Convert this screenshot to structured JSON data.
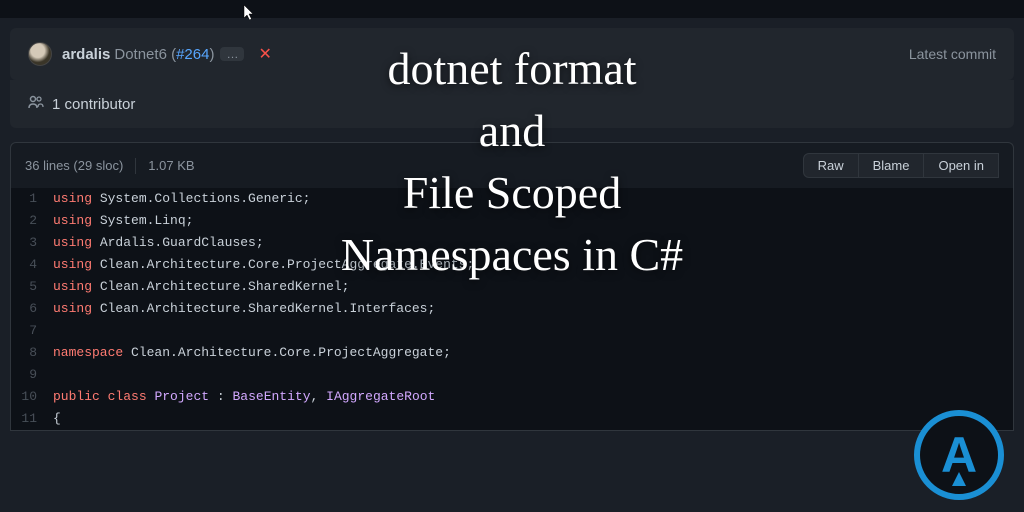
{
  "overlay": {
    "line1": "dotnet format",
    "line2": "and",
    "line3": "File Scoped",
    "line4": "Namespaces in C#"
  },
  "commit": {
    "author": "ardalis",
    "message_prefix": "Dotnet6 (",
    "pr_link": "#264",
    "message_suffix": ")",
    "latest_commit_label": "Latest commit"
  },
  "contributors": {
    "count_label": "1 contributor"
  },
  "file_header": {
    "lines": "36 lines (29 sloc)",
    "size": "1.07 KB",
    "actions": {
      "raw": "Raw",
      "blame": "Blame",
      "open": "Open in"
    }
  },
  "code_lines": [
    {
      "n": "1",
      "using": "using",
      "ns": "System.Collections.Generic"
    },
    {
      "n": "2",
      "using": "using",
      "ns": "System.Linq"
    },
    {
      "n": "3",
      "using": "using",
      "ns": "Ardalis.GuardClauses"
    },
    {
      "n": "4",
      "using": "using",
      "ns": "Clean.Architecture.Core.ProjectAggregate.Events"
    },
    {
      "n": "5",
      "using": "using",
      "ns": "Clean.Architecture.SharedKernel"
    },
    {
      "n": "6",
      "using": "using",
      "ns": "Clean.Architecture.SharedKernel.Interfaces"
    }
  ],
  "blank7": "7",
  "line8": {
    "n": "8",
    "kw": "namespace",
    "ns": "Clean.Architecture.Core.ProjectAggregate"
  },
  "blank9": "9",
  "line10": {
    "n": "10",
    "pub": "public",
    "cls_kw": "class",
    "cls_name": "Project",
    "base": "BaseEntity",
    "iface": "IAggregateRoot"
  },
  "line11": {
    "n": "11",
    "brace": "{"
  },
  "logo_letter": "A"
}
